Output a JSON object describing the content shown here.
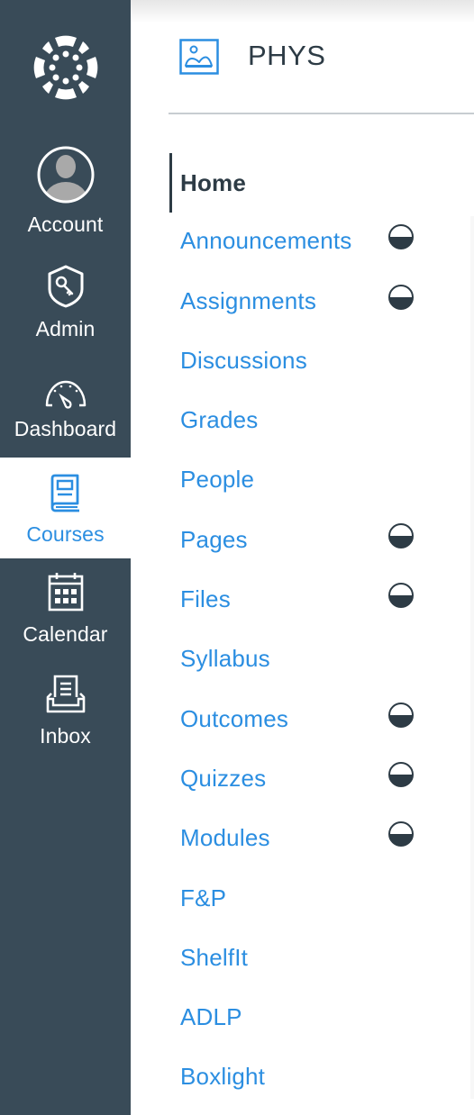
{
  "global_nav": {
    "logo": "canvas-logo",
    "items": [
      {
        "label": "Account",
        "icon": "avatar-icon",
        "active": false
      },
      {
        "label": "Admin",
        "icon": "shield-key-icon",
        "active": false
      },
      {
        "label": "Dashboard",
        "icon": "dashboard-gauge-icon",
        "active": false
      },
      {
        "label": "Courses",
        "icon": "book-icon",
        "active": true
      },
      {
        "label": "Calendar",
        "icon": "calendar-icon",
        "active": false
      },
      {
        "label": "Inbox",
        "icon": "inbox-icon",
        "active": false
      }
    ]
  },
  "course": {
    "title": "PHYS",
    "image_icon": "image-icon"
  },
  "course_nav": {
    "items": [
      {
        "label": "Home",
        "active": true,
        "hidden_indicator": false
      },
      {
        "label": "Announcements",
        "active": false,
        "hidden_indicator": true
      },
      {
        "label": "Assignments",
        "active": false,
        "hidden_indicator": true
      },
      {
        "label": "Discussions",
        "active": false,
        "hidden_indicator": false
      },
      {
        "label": "Grades",
        "active": false,
        "hidden_indicator": false
      },
      {
        "label": "People",
        "active": false,
        "hidden_indicator": false
      },
      {
        "label": "Pages",
        "active": false,
        "hidden_indicator": true
      },
      {
        "label": "Files",
        "active": false,
        "hidden_indicator": true
      },
      {
        "label": "Syllabus",
        "active": false,
        "hidden_indicator": false
      },
      {
        "label": "Outcomes",
        "active": false,
        "hidden_indicator": true
      },
      {
        "label": "Quizzes",
        "active": false,
        "hidden_indicator": true
      },
      {
        "label": "Modules",
        "active": false,
        "hidden_indicator": true
      },
      {
        "label": "F&P",
        "active": false,
        "hidden_indicator": false
      },
      {
        "label": "ShelfIt",
        "active": false,
        "hidden_indicator": false
      },
      {
        "label": "ADLP",
        "active": false,
        "hidden_indicator": false
      },
      {
        "label": "Boxlight",
        "active": false,
        "hidden_indicator": false
      }
    ]
  },
  "colors": {
    "nav_bg": "#394b58",
    "link": "#2b8ee1",
    "text_dark": "#2d3b45"
  }
}
